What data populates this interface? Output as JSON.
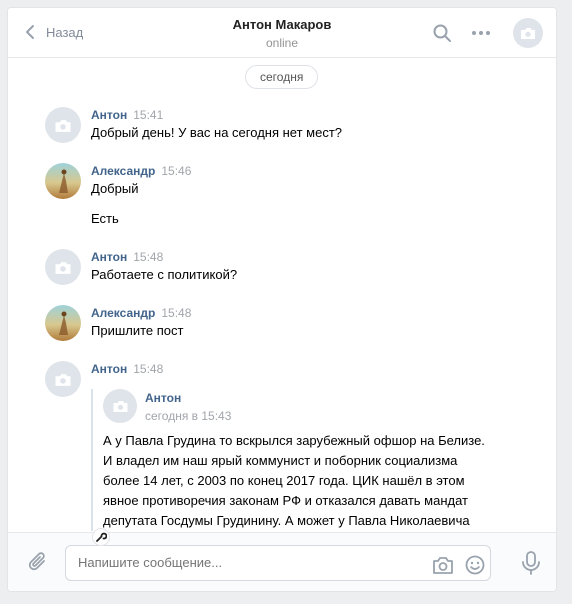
{
  "header": {
    "back_label": "Назад",
    "title": "Антон Макаров",
    "status": "online"
  },
  "feed": {
    "date_label": "сегодня",
    "messages": [
      {
        "author": "Антон",
        "time": "15:41",
        "texts": [
          "Добрый день! У вас на сегодня нет мест?"
        ]
      },
      {
        "author": "Александр",
        "time": "15:46",
        "texts": [
          "Добрый",
          "Есть"
        ]
      },
      {
        "author": "Антон",
        "time": "15:48",
        "texts": [
          "Работаете с политикой?"
        ]
      },
      {
        "author": "Александр",
        "time": "15:48",
        "texts": [
          "Пришлите пост"
        ]
      },
      {
        "author": "Антон",
        "time": "15:48",
        "forwarded": {
          "author": "Антон",
          "date": "сегодня в 15:43",
          "text": "А у Павла Грудина то вскрылся зарубежный офшор на Белизе. И владел им наш ярый коммунист и поборник социализма более 14 лет, с 2003 по конец 2017 года. ЦИК нашёл в этом явное противоречия законам РФ и отказался давать мандат депутата Госдумы Грудинину. А может у Павла Николаевича ещё какие-то счета есть о которых он,"
        }
      }
    ]
  },
  "composer": {
    "placeholder": "Напишите сообщение..."
  },
  "icons": {
    "back": "chevron-left-icon",
    "search": "search-icon",
    "more": "more-dots-icon",
    "camera": "camera-icon",
    "attach": "paperclip-icon",
    "emoji": "smile-icon",
    "mic": "microphone-icon",
    "wrench": "wrench-icon"
  },
  "colors": {
    "name": "#42648b",
    "time": "#a1a5ab",
    "icon": "#99a2ad",
    "background": "#edeef0"
  }
}
